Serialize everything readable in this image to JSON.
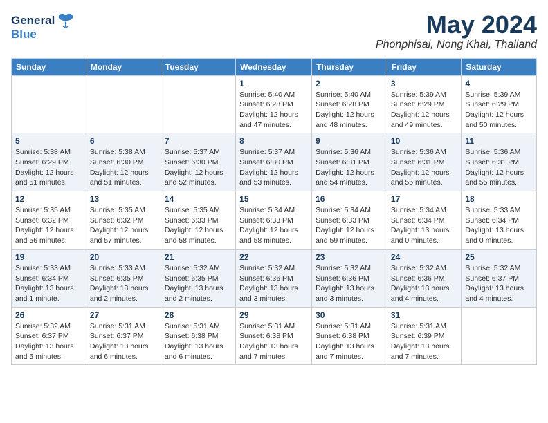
{
  "header": {
    "logo_line1": "General",
    "logo_line2": "Blue",
    "month": "May 2024",
    "location": "Phonphisai, Nong Khai, Thailand"
  },
  "weekdays": [
    "Sunday",
    "Monday",
    "Tuesday",
    "Wednesday",
    "Thursday",
    "Friday",
    "Saturday"
  ],
  "weeks": [
    [
      {
        "day": "",
        "info": ""
      },
      {
        "day": "",
        "info": ""
      },
      {
        "day": "",
        "info": ""
      },
      {
        "day": "1",
        "info": "Sunrise: 5:40 AM\nSunset: 6:28 PM\nDaylight: 12 hours\nand 47 minutes."
      },
      {
        "day": "2",
        "info": "Sunrise: 5:40 AM\nSunset: 6:28 PM\nDaylight: 12 hours\nand 48 minutes."
      },
      {
        "day": "3",
        "info": "Sunrise: 5:39 AM\nSunset: 6:29 PM\nDaylight: 12 hours\nand 49 minutes."
      },
      {
        "day": "4",
        "info": "Sunrise: 5:39 AM\nSunset: 6:29 PM\nDaylight: 12 hours\nand 50 minutes."
      }
    ],
    [
      {
        "day": "5",
        "info": "Sunrise: 5:38 AM\nSunset: 6:29 PM\nDaylight: 12 hours\nand 51 minutes."
      },
      {
        "day": "6",
        "info": "Sunrise: 5:38 AM\nSunset: 6:30 PM\nDaylight: 12 hours\nand 51 minutes."
      },
      {
        "day": "7",
        "info": "Sunrise: 5:37 AM\nSunset: 6:30 PM\nDaylight: 12 hours\nand 52 minutes."
      },
      {
        "day": "8",
        "info": "Sunrise: 5:37 AM\nSunset: 6:30 PM\nDaylight: 12 hours\nand 53 minutes."
      },
      {
        "day": "9",
        "info": "Sunrise: 5:36 AM\nSunset: 6:31 PM\nDaylight: 12 hours\nand 54 minutes."
      },
      {
        "day": "10",
        "info": "Sunrise: 5:36 AM\nSunset: 6:31 PM\nDaylight: 12 hours\nand 55 minutes."
      },
      {
        "day": "11",
        "info": "Sunrise: 5:36 AM\nSunset: 6:31 PM\nDaylight: 12 hours\nand 55 minutes."
      }
    ],
    [
      {
        "day": "12",
        "info": "Sunrise: 5:35 AM\nSunset: 6:32 PM\nDaylight: 12 hours\nand 56 minutes."
      },
      {
        "day": "13",
        "info": "Sunrise: 5:35 AM\nSunset: 6:32 PM\nDaylight: 12 hours\nand 57 minutes."
      },
      {
        "day": "14",
        "info": "Sunrise: 5:35 AM\nSunset: 6:33 PM\nDaylight: 12 hours\nand 58 minutes."
      },
      {
        "day": "15",
        "info": "Sunrise: 5:34 AM\nSunset: 6:33 PM\nDaylight: 12 hours\nand 58 minutes."
      },
      {
        "day": "16",
        "info": "Sunrise: 5:34 AM\nSunset: 6:33 PM\nDaylight: 12 hours\nand 59 minutes."
      },
      {
        "day": "17",
        "info": "Sunrise: 5:34 AM\nSunset: 6:34 PM\nDaylight: 13 hours\nand 0 minutes."
      },
      {
        "day": "18",
        "info": "Sunrise: 5:33 AM\nSunset: 6:34 PM\nDaylight: 13 hours\nand 0 minutes."
      }
    ],
    [
      {
        "day": "19",
        "info": "Sunrise: 5:33 AM\nSunset: 6:34 PM\nDaylight: 13 hours\nand 1 minute."
      },
      {
        "day": "20",
        "info": "Sunrise: 5:33 AM\nSunset: 6:35 PM\nDaylight: 13 hours\nand 2 minutes."
      },
      {
        "day": "21",
        "info": "Sunrise: 5:32 AM\nSunset: 6:35 PM\nDaylight: 13 hours\nand 2 minutes."
      },
      {
        "day": "22",
        "info": "Sunrise: 5:32 AM\nSunset: 6:36 PM\nDaylight: 13 hours\nand 3 minutes."
      },
      {
        "day": "23",
        "info": "Sunrise: 5:32 AM\nSunset: 6:36 PM\nDaylight: 13 hours\nand 3 minutes."
      },
      {
        "day": "24",
        "info": "Sunrise: 5:32 AM\nSunset: 6:36 PM\nDaylight: 13 hours\nand 4 minutes."
      },
      {
        "day": "25",
        "info": "Sunrise: 5:32 AM\nSunset: 6:37 PM\nDaylight: 13 hours\nand 4 minutes."
      }
    ],
    [
      {
        "day": "26",
        "info": "Sunrise: 5:32 AM\nSunset: 6:37 PM\nDaylight: 13 hours\nand 5 minutes."
      },
      {
        "day": "27",
        "info": "Sunrise: 5:31 AM\nSunset: 6:37 PM\nDaylight: 13 hours\nand 6 minutes."
      },
      {
        "day": "28",
        "info": "Sunrise: 5:31 AM\nSunset: 6:38 PM\nDaylight: 13 hours\nand 6 minutes."
      },
      {
        "day": "29",
        "info": "Sunrise: 5:31 AM\nSunset: 6:38 PM\nDaylight: 13 hours\nand 7 minutes."
      },
      {
        "day": "30",
        "info": "Sunrise: 5:31 AM\nSunset: 6:38 PM\nDaylight: 13 hours\nand 7 minutes."
      },
      {
        "day": "31",
        "info": "Sunrise: 5:31 AM\nSunset: 6:39 PM\nDaylight: 13 hours\nand 7 minutes."
      },
      {
        "day": "",
        "info": ""
      }
    ]
  ]
}
